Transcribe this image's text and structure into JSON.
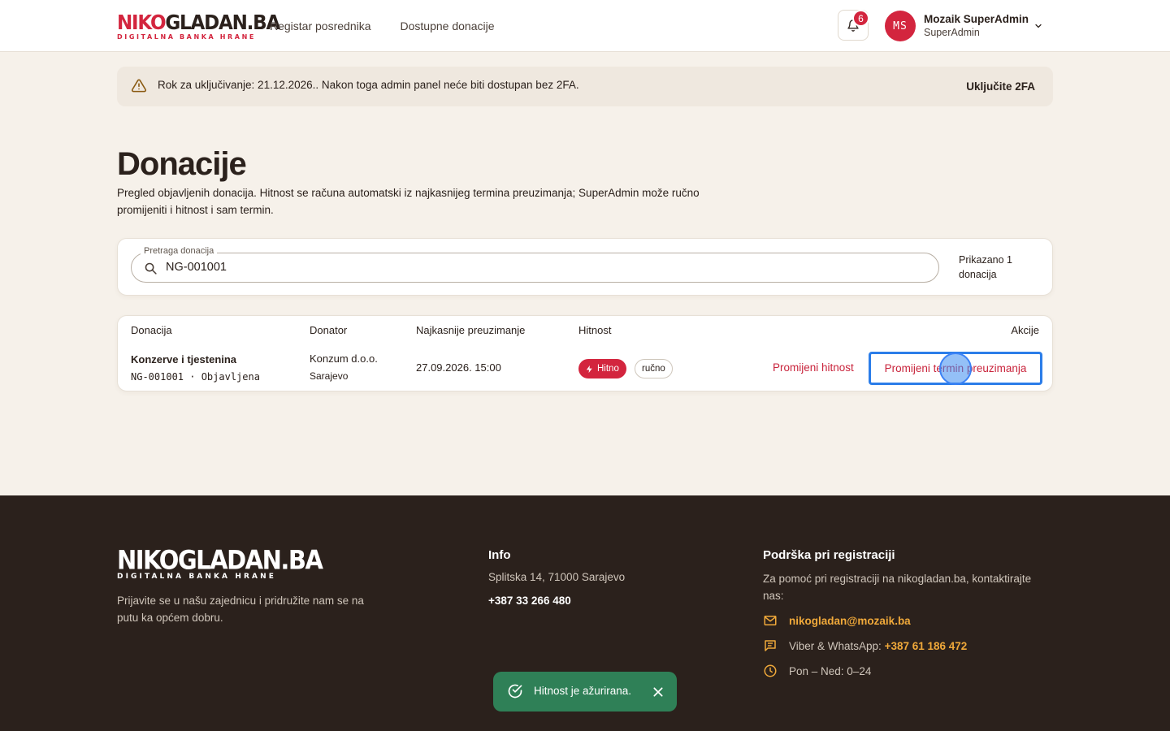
{
  "header": {
    "logo_main_red": "NIKO",
    "logo_main_rest": "GLADAN.BA",
    "logo_sub": "DIGITALNA BANKA HRANE",
    "nav": [
      "Registar posrednika",
      "Dostupne donacije"
    ],
    "notifications_count": "6",
    "avatar_initials": "MS",
    "user_name": "Mozaik SuperAdmin",
    "user_role": "SuperAdmin"
  },
  "banner": {
    "text": "Rok za uključivanje: 21.12.2026.. Nakon toga admin panel neće biti dostupan bez 2FA.",
    "action": "Uključite 2FA"
  },
  "page": {
    "title": "Donacije",
    "subtitle": "Pregled objavljenih donacija. Hitnost se računa automatski iz najkasnijeg termina preuzimanja; SuperAdmin može ručno promijeniti i hitnost i sam termin."
  },
  "search": {
    "legend": "Pretraga donacija",
    "value": "NG-001001",
    "count": "Prikazano 1 donacija"
  },
  "table": {
    "columns": [
      "Donacija",
      "Donator",
      "Najkasnije preuzimanje",
      "Hitnost",
      "Akcije"
    ],
    "rows": [
      {
        "title": "Konzerve i tjestenina",
        "id_status": "NG-001001 · Objavljena",
        "donor": "Konzum d.o.o.",
        "city": "Sarajevo",
        "pickup": "27.09.2026. 15:00",
        "urgency": "Hitno",
        "mode": "ručno",
        "action_urgency": "Promijeni hitnost",
        "action_term": "Promijeni termin preuzimanja"
      }
    ]
  },
  "footer": {
    "logo_main": "NIKOGLADAN.BA",
    "logo_sub": "DIGITALNA BANKA HRANE",
    "tagline": "Prijavite se u našu zajednicu i pridružite nam se na putu ka općem dobru.",
    "info_title": "Info",
    "address": "Splitska 14, 71000 Sarajevo",
    "phone": "+387 33 266 480",
    "support_title": "Podrška pri registraciji",
    "support_text": "Za pomoć pri registraciji na nikogladan.ba, kontaktirajte nas:",
    "email": "nikogladan@mozaik.ba",
    "viber_label": "Viber & WhatsApp:",
    "viber_number": "+387 61 186 472",
    "hours": "Pon – Ned: 0–24"
  },
  "toast": {
    "text": "Hitnost je ažurirana."
  },
  "colors": {
    "brand_red": "#d3253e",
    "footer_bg": "#2b211c",
    "page_bg": "#f6f1ea",
    "accent_orange": "#f0a93a",
    "toast_green": "#2f8057",
    "focus_blue": "#2b7de9"
  },
  "icons": [
    "bell-icon",
    "chevron-down-icon",
    "warning-icon",
    "search-icon",
    "bolt-icon",
    "mail-icon",
    "chat-icon",
    "clock-icon",
    "check-circle-icon",
    "close-icon"
  ]
}
